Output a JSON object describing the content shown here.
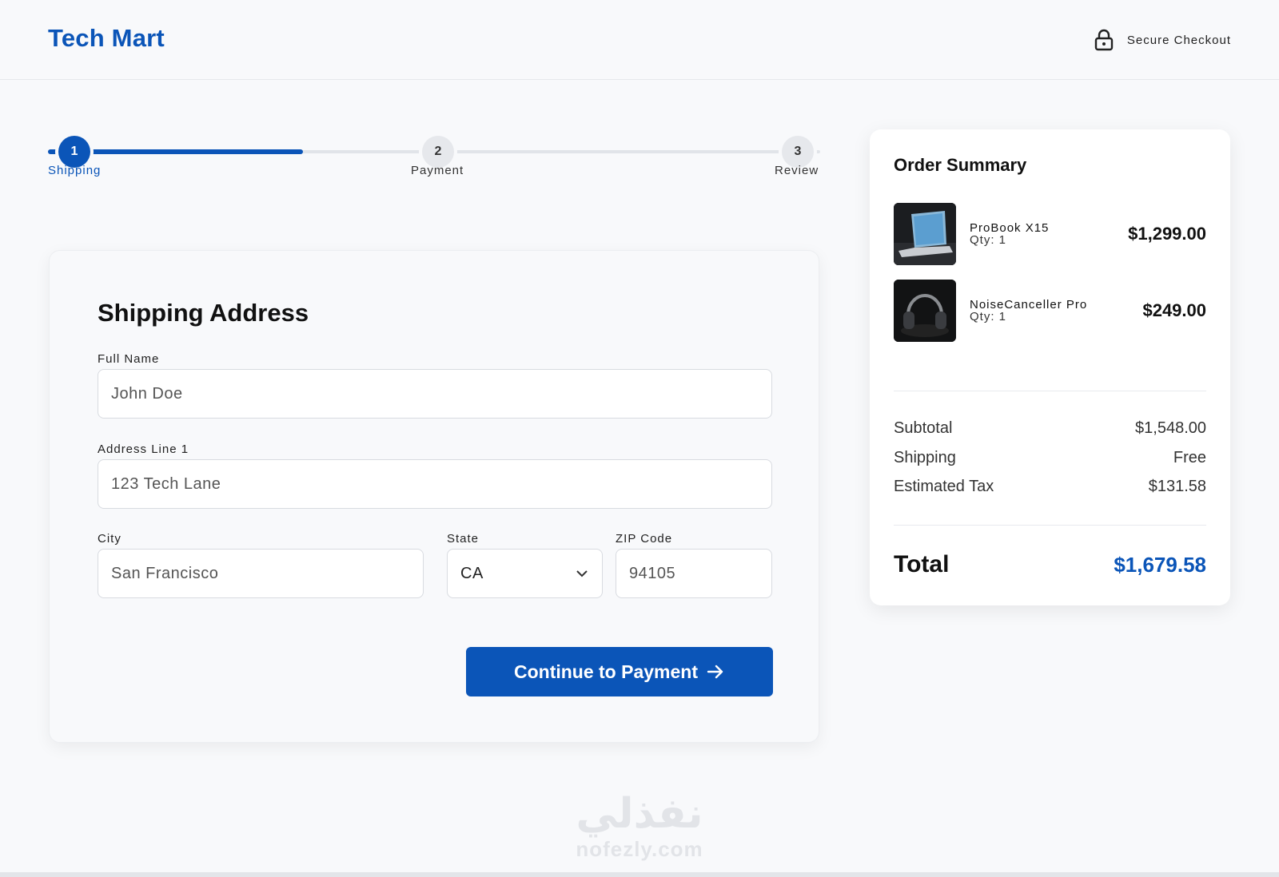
{
  "header": {
    "brand": "Tech Mart",
    "secure_label": "Secure Checkout",
    "secure_icon": "lock-icon"
  },
  "stepper": {
    "progress": 0.33,
    "steps": [
      {
        "number": "1",
        "label": "Shipping",
        "state": "active"
      },
      {
        "number": "2",
        "label": "Payment",
        "state": "inactive"
      },
      {
        "number": "3",
        "label": "Review",
        "state": "inactive"
      }
    ]
  },
  "form": {
    "title": "Shipping Address",
    "full_name": {
      "label": "Full Name",
      "value": "John Doe"
    },
    "address_line1": {
      "label": "Address Line 1",
      "value": "123 Tech Lane"
    },
    "city": {
      "label": "City",
      "value": "San Francisco"
    },
    "state": {
      "label": "State",
      "value": "CA"
    },
    "zip": {
      "label": "ZIP Code",
      "value": "94105"
    },
    "continue_label": "Continue to Payment"
  },
  "summary": {
    "title": "Order Summary",
    "items": [
      {
        "name": "ProBook X15",
        "qty": "Qty: 1",
        "price": "$1,299.00",
        "image": "laptop"
      },
      {
        "name": "NoiseCanceller Pro",
        "qty": "Qty: 1",
        "price": "$249.00",
        "image": "headphones"
      }
    ],
    "subtotal_label": "Subtotal",
    "subtotal_value": "$1,548.00",
    "shipping_label": "Shipping",
    "shipping_value": "Free",
    "tax_label": "Estimated Tax",
    "tax_value": "$131.58",
    "total_label": "Total",
    "total_value": "$1,679.58"
  },
  "watermark": {
    "logo_text": "نفذلي",
    "url": "nofezly.com"
  },
  "colors": {
    "accent": "#0b55b8",
    "background": "#f8f9fb",
    "card": "#ffffff"
  }
}
